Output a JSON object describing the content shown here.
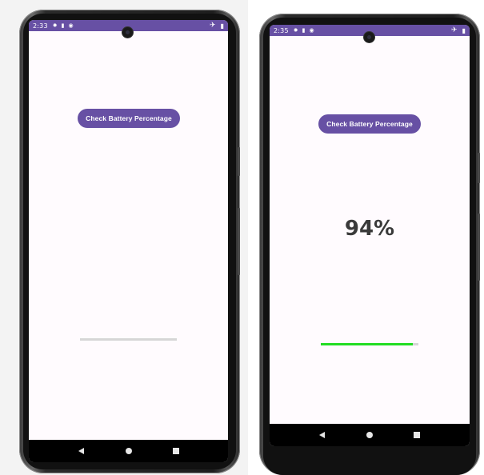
{
  "colors": {
    "status_bar": "#6750a4",
    "button": "#6750a4",
    "screen_bg": "#fffbfe",
    "progress_fill": "#22dd22",
    "progress_track": "#d6d6d6",
    "nav_bar": "#000000"
  },
  "phone_left": {
    "status_bar": {
      "time": "2:33",
      "icons": [
        "gear-icon",
        "sd-card-icon",
        "circle-a-icon"
      ],
      "right_icons": [
        "airplane-icon",
        "battery-icon"
      ]
    },
    "button_label": "Check Battery Percentage",
    "percentage_text": "",
    "progress": 0
  },
  "phone_right": {
    "status_bar": {
      "time": "2:35",
      "icons": [
        "gear-icon",
        "sd-card-icon",
        "circle-a-icon"
      ],
      "right_icons": [
        "airplane-icon",
        "battery-icon"
      ]
    },
    "button_label": "Check Battery Percentage",
    "percentage_text": "94%",
    "progress": 0.94
  },
  "nav": {
    "icons": [
      "back-icon",
      "home-icon",
      "recents-icon"
    ]
  }
}
